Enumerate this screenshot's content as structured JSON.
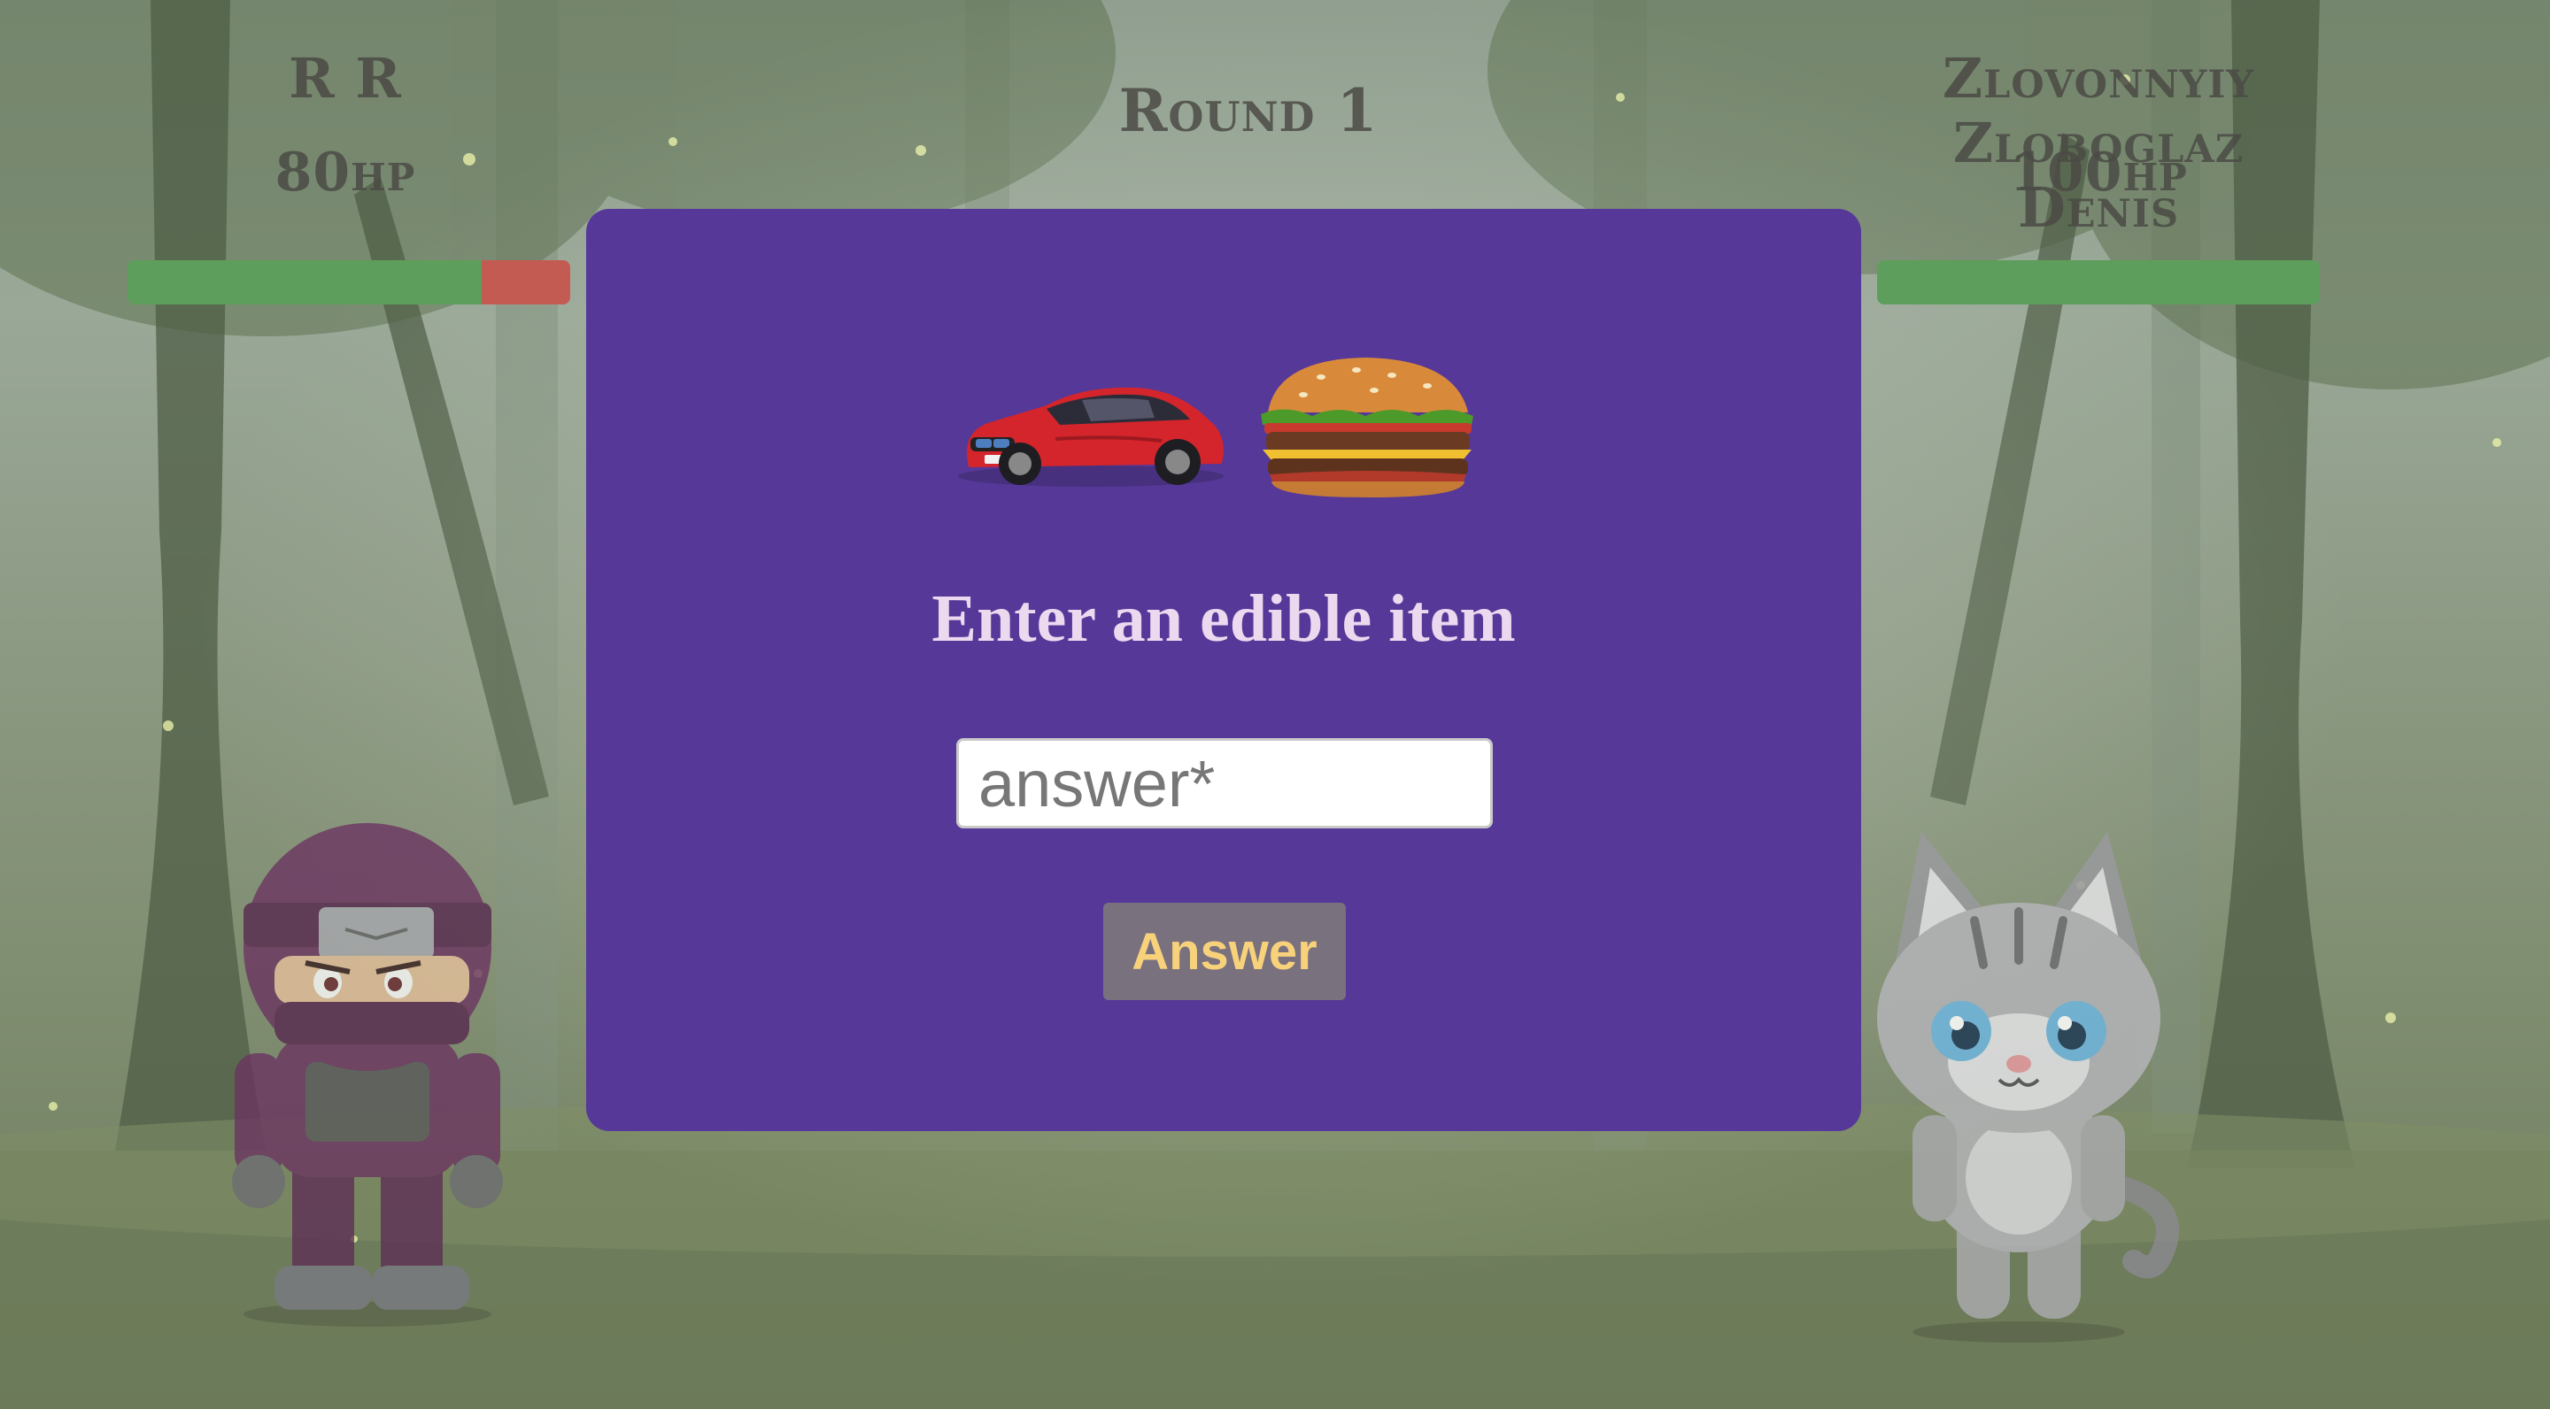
{
  "round": {
    "label": "Round 1"
  },
  "player_left": {
    "name": "R R",
    "hp_text": "80hp",
    "hp_fraction": 0.8,
    "character": "ninja-character"
  },
  "player_right": {
    "name": "Zlovonnyiy Zloboglaz Denis",
    "hp_text": "100hp",
    "hp_fraction": 1.0,
    "character": "cat-character"
  },
  "modal": {
    "images": [
      "red-sports-car-image",
      "hamburger-image"
    ],
    "prompt": "Enter an edible item",
    "input_placeholder": "answer*",
    "input_value": "",
    "button_label": "Answer"
  },
  "colors": {
    "modal_bg": "#563899",
    "hp_green": "#5e9e5c",
    "hp_red": "#c45b52",
    "prompt_text": "#ecd9ef",
    "button_bg": "#7a717f",
    "button_text": "#f7d27a"
  }
}
